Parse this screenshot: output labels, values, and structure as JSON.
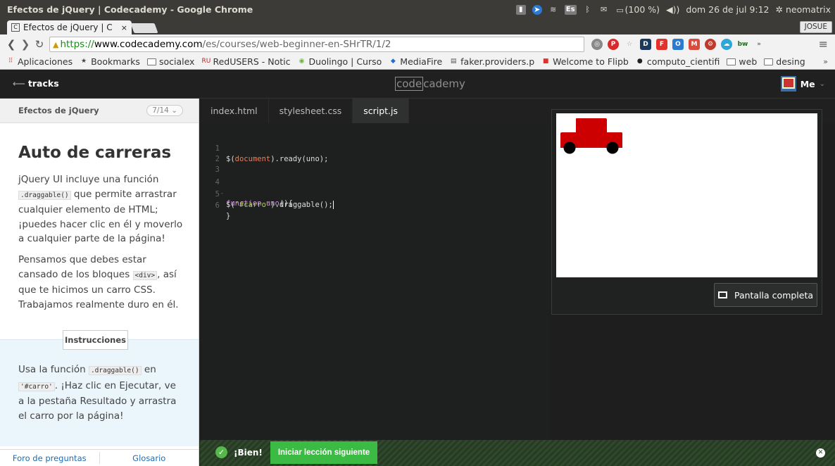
{
  "os": {
    "window_title": "Efectos de jQuery | Codecademy - Google Chrome",
    "keyboard": "Es",
    "battery": "(100 %)",
    "volume": "◀))",
    "datetime": "dom 26 de jul  9:12",
    "user": "neomatrix"
  },
  "browser": {
    "tab_title": "Efectos de jQuery | C",
    "tab_close": "×",
    "profile": "JOSUE",
    "url_scheme": "https://",
    "url_host": "www.codecademy.com",
    "url_path": "/es/courses/web-beginner-en-SHrTR/1/2",
    "bookmarks": [
      {
        "label": "Aplicaciones",
        "icon": "apps-grid-icon"
      },
      {
        "label": "Bookmarks",
        "icon": "star-icon"
      },
      {
        "label": "socialex",
        "icon": "folder-icon"
      },
      {
        "label": "RedUSERS - Notic",
        "icon": "ru-icon"
      },
      {
        "label": "Duolingo | Curso",
        "icon": "duolingo-icon"
      },
      {
        "label": "MediaFire",
        "icon": "mediafire-icon"
      },
      {
        "label": "faker.providers.p",
        "icon": "doc-icon"
      },
      {
        "label": "Welcome to Flipb",
        "icon": "flipboard-icon"
      },
      {
        "label": "computo_cientifi",
        "icon": "github-icon"
      },
      {
        "label": "web",
        "icon": "folder-icon"
      },
      {
        "label": "desing",
        "icon": "folder-icon"
      }
    ],
    "bookmarks_more": "»"
  },
  "header": {
    "tracks": "tracks",
    "logo_a": "code",
    "logo_b": "cademy",
    "user": "Me"
  },
  "lesson": {
    "name": "Efectos de jQuery",
    "progress": "7/14",
    "title": "Auto de carreras",
    "para1_a": "jQuery UI incluye una función ",
    "para1_code": ".draggable()",
    "para1_b": " que permite arrastrar cualquier elemento de HTML; ¡puedes hacer clic en él y moverlo a cualquier parte de la página!",
    "para2_a": "Pensamos que debes estar cansado de los bloques ",
    "para2_code": "<div>",
    "para2_b": ", así que te hicimos un carro CSS. Trabajamos realmente duro en él.",
    "instructions_label": "Instrucciones",
    "instr_a": "Usa la función ",
    "instr_code1": ".draggable()",
    "instr_b": " en ",
    "instr_code2": "'#carro'",
    "instr_c": ". ¡Haz clic en Ejecutar, ve a la pestaña Resultado y arrastra el carro por la página!",
    "forum": "Foro de preguntas",
    "glossary": "Glosario"
  },
  "editor": {
    "tabs": [
      "index.html",
      "stylesheet.css",
      "script.js"
    ],
    "active_tab": "script.js",
    "line_numbers": [
      "1",
      "2",
      "3",
      "4",
      "5",
      "6"
    ],
    "fold_marker": "-",
    "l1_a": "$(",
    "l1_b": "document",
    "l1_c": ").ready(uno);",
    "l4_a": "function ",
    "l4_b": "uno",
    "l4_c": "(){",
    "l5_a": "$(",
    "l5_b": "'#carro'",
    "l5_c": ").draggable();",
    "l6": "}"
  },
  "result": {
    "fullscreen": "Pantalla completa",
    "car_color": "#cc0000"
  },
  "success": {
    "text": "¡Bien!",
    "next": "Iniciar lección siguiente"
  }
}
